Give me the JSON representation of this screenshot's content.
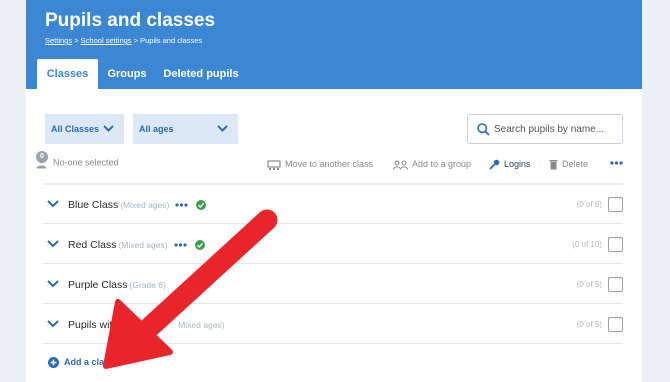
{
  "header": {
    "title": "Pupils and classes",
    "breadcrumb": {
      "settings": "Settings",
      "sep1": " > ",
      "school_settings": "School settings",
      "sep2": " > ",
      "current": "Pupils and classes"
    }
  },
  "tabs": [
    {
      "label": "Classes",
      "active": true
    },
    {
      "label": "Groups",
      "active": false
    },
    {
      "label": "Deleted pupils",
      "active": false
    }
  ],
  "filters": {
    "class_select": "All Classes",
    "age_select": "All ages",
    "search_placeholder": "Search pupils by name..."
  },
  "toolbar": {
    "selected_count": "0",
    "selected_label": "No-one selected",
    "move": "Move to another class",
    "add_group": "Add to a group",
    "logins": "Logins",
    "delete": "Delete"
  },
  "classes": [
    {
      "name": "Blue Class",
      "sub": "(Mixed ages)",
      "count": "(0 of 6)",
      "has_menu": true,
      "verified": true
    },
    {
      "name": "Red Class",
      "sub": "(Mixed ages)",
      "count": "(0 of 10)",
      "has_menu": true,
      "verified": true
    },
    {
      "name": "Purple Class",
      "sub": "(Grade 6)",
      "count": "(0 of 5)",
      "has_menu": false,
      "verified": false
    },
    {
      "name": "Pupils with",
      "sub": "Mixed ages)",
      "count": "(0 of 5)",
      "has_menu": false,
      "verified": false
    }
  ],
  "add_class": "Add a class",
  "colors": {
    "header_blue": "#3b87d4",
    "link_blue": "#2a6ab8",
    "check_green": "#3aa04a",
    "arrow_red": "#e8252a"
  }
}
